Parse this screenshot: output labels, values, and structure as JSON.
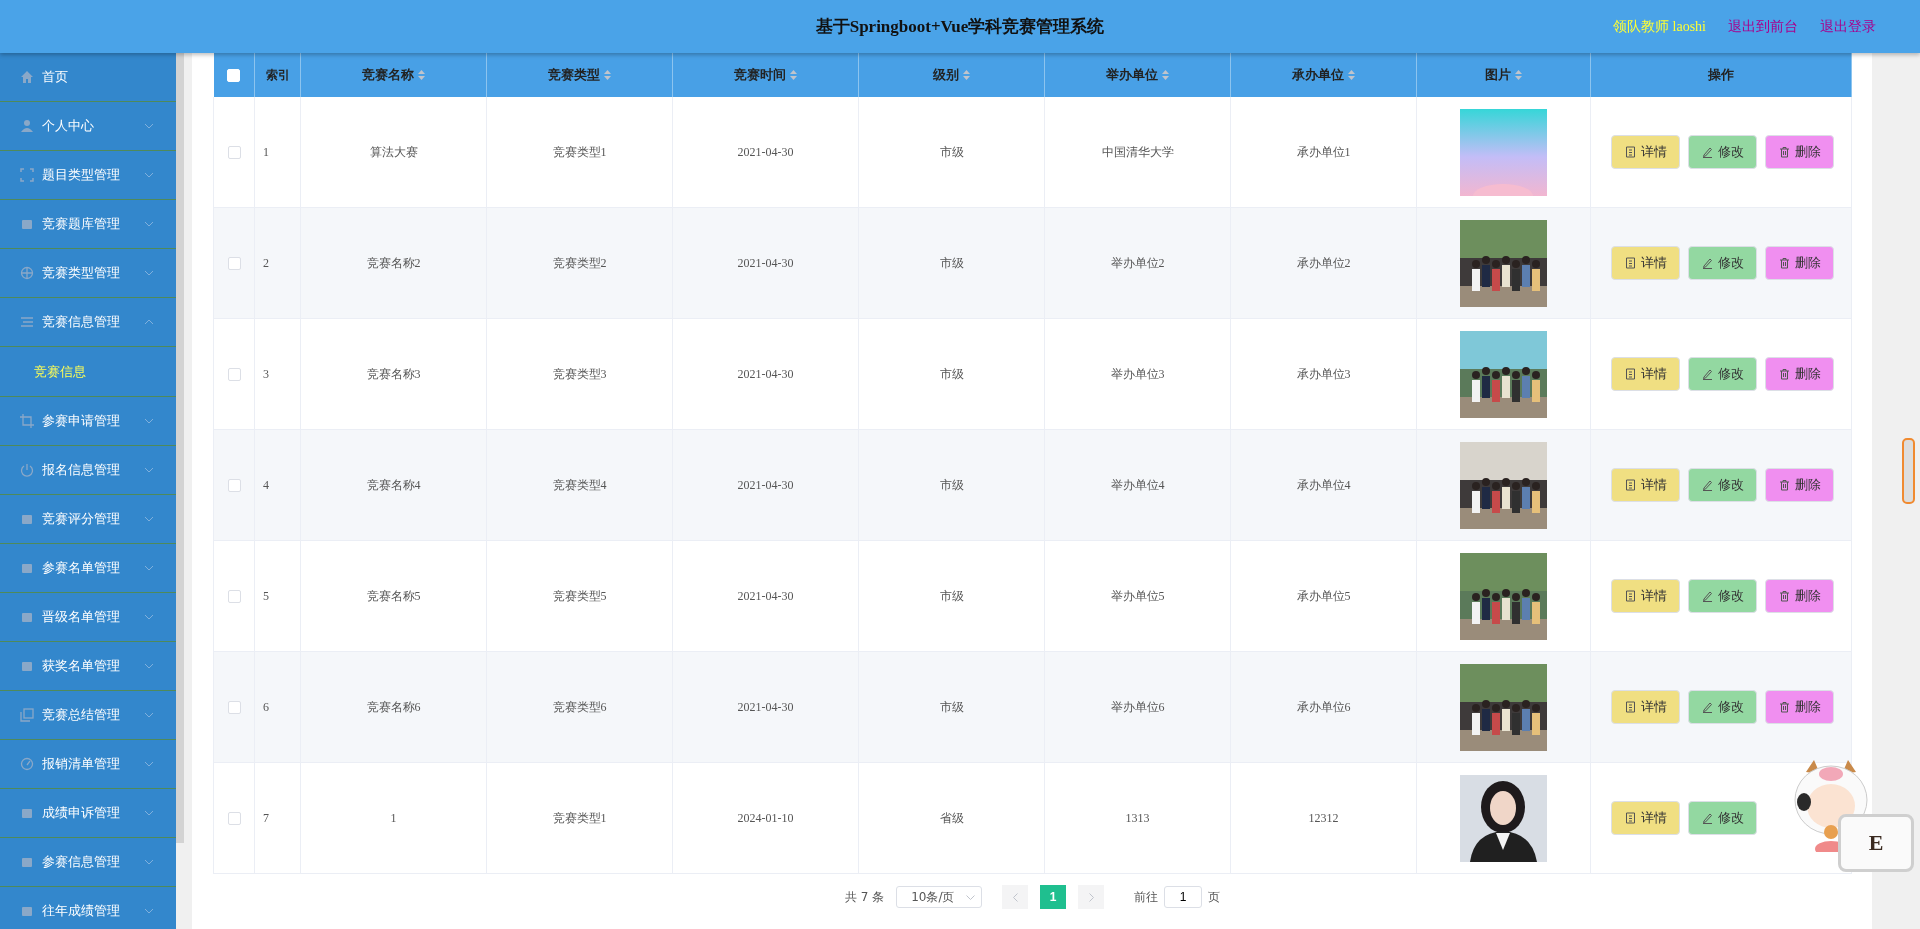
{
  "header": {
    "title": "基于Springboot+Vue学科竞赛管理系统",
    "user": "领队教师 laoshi",
    "links": [
      "退出到前台",
      "退出登录"
    ]
  },
  "sidebar": {
    "items": [
      {
        "label": "首页",
        "selected": false
      },
      {
        "label": "个人中心",
        "expanded": false
      },
      {
        "label": "题目类型管理",
        "expanded": false
      },
      {
        "label": "竞赛题库管理",
        "expanded": false
      },
      {
        "label": "竞赛类型管理",
        "expanded": false
      },
      {
        "label": "竞赛信息管理",
        "expanded": true,
        "children": [
          {
            "label": "竞赛信息",
            "selected": true
          }
        ]
      },
      {
        "label": "参赛申请管理",
        "expanded": false
      },
      {
        "label": "报名信息管理",
        "expanded": false
      },
      {
        "label": "竞赛评分管理",
        "expanded": false
      },
      {
        "label": "参赛名单管理",
        "expanded": false
      },
      {
        "label": "晋级名单管理",
        "expanded": false
      },
      {
        "label": "获奖名单管理",
        "expanded": false
      },
      {
        "label": "竞赛总结管理",
        "expanded": false
      },
      {
        "label": "报销清单管理",
        "expanded": false
      },
      {
        "label": "成绩申诉管理",
        "expanded": false
      },
      {
        "label": "参赛信息管理",
        "expanded": false
      },
      {
        "label": "往年成绩管理",
        "expanded": false
      }
    ]
  },
  "table": {
    "select_all": {
      "checked": false
    },
    "columns": [
      {
        "label": "索引",
        "sortable": false
      },
      {
        "label": "竞赛名称",
        "sortable": true
      },
      {
        "label": "竞赛类型",
        "sortable": true
      },
      {
        "label": "竞赛时间",
        "sortable": true
      },
      {
        "label": "级别",
        "sortable": true
      },
      {
        "label": "举办单位",
        "sortable": true
      },
      {
        "label": "承办单位",
        "sortable": true
      },
      {
        "label": "图片",
        "sortable": true
      },
      {
        "label": "操作",
        "sortable": false
      }
    ],
    "rows": [
      {
        "checked": false,
        "cells": [
          "1",
          "算法大赛",
          "竞赛类型1",
          "2021-04-30",
          "市级",
          "中国清华大学",
          "承办单位1"
        ],
        "image": {
          "kind": "picture"
        },
        "actions": [
          {
            "kind": "detail",
            "label": "详情"
          },
          {
            "kind": "edit",
            "label": "修改"
          },
          {
            "kind": "delete",
            "label": "删除"
          }
        ]
      },
      {
        "checked": false,
        "cells": [
          "2",
          "竞赛名称2",
          "竞赛类型2",
          "2021-04-30",
          "市级",
          "举办单位2",
          "承办单位2"
        ],
        "image": {
          "kind": "picture"
        },
        "actions": [
          {
            "kind": "detail",
            "label": "详情"
          },
          {
            "kind": "edit",
            "label": "修改"
          },
          {
            "kind": "delete",
            "label": "删除"
          }
        ]
      },
      {
        "checked": false,
        "cells": [
          "3",
          "竞赛名称3",
          "竞赛类型3",
          "2021-04-30",
          "市级",
          "举办单位3",
          "承办单位3"
        ],
        "image": {
          "kind": "picture"
        },
        "actions": [
          {
            "kind": "detail",
            "label": "详情"
          },
          {
            "kind": "edit",
            "label": "修改"
          },
          {
            "kind": "delete",
            "label": "删除"
          }
        ]
      },
      {
        "checked": false,
        "cells": [
          "4",
          "竞赛名称4",
          "竞赛类型4",
          "2021-04-30",
          "市级",
          "举办单位4",
          "承办单位4"
        ],
        "image": {
          "kind": "picture"
        },
        "actions": [
          {
            "kind": "detail",
            "label": "详情"
          },
          {
            "kind": "edit",
            "label": "修改"
          },
          {
            "kind": "delete",
            "label": "删除"
          }
        ]
      },
      {
        "checked": false,
        "cells": [
          "5",
          "竞赛名称5",
          "竞赛类型5",
          "2021-04-30",
          "市级",
          "举办单位5",
          "承办单位5"
        ],
        "image": {
          "kind": "picture"
        },
        "actions": [
          {
            "kind": "detail",
            "label": "详情"
          },
          {
            "kind": "edit",
            "label": "修改"
          },
          {
            "kind": "delete",
            "label": "删除"
          }
        ]
      },
      {
        "checked": false,
        "cells": [
          "6",
          "竞赛名称6",
          "竞赛类型6",
          "2021-04-30",
          "市级",
          "举办单位6",
          "承办单位6"
        ],
        "image": {
          "kind": "picture"
        },
        "actions": [
          {
            "kind": "detail",
            "label": "详情"
          },
          {
            "kind": "edit",
            "label": "修改"
          },
          {
            "kind": "delete",
            "label": "删除"
          }
        ]
      },
      {
        "checked": false,
        "cells": [
          "7",
          "1",
          "竞赛类型1",
          "2024-01-10",
          "省级",
          "1313",
          "12312"
        ],
        "image": {
          "kind": "picture"
        },
        "actions": [
          {
            "kind": "detail",
            "label": "详情"
          },
          {
            "kind": "edit",
            "label": "修改"
          }
        ]
      }
    ]
  },
  "pagination": {
    "total": "共 7 条",
    "page_size": "10条/页",
    "pages": [
      {
        "label": "1",
        "selected": true
      }
    ],
    "goto_label": "前往",
    "goto_value": "1",
    "goto_unit": "页"
  },
  "mascot": {
    "badge": "E"
  }
}
